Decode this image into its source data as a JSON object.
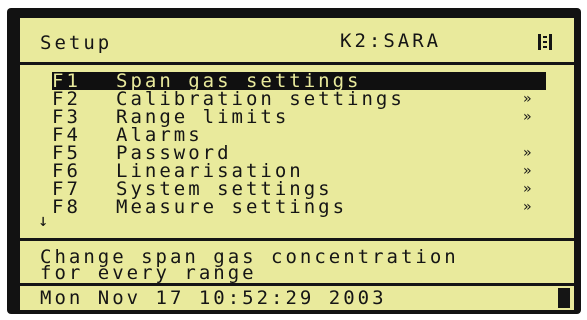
{
  "header": {
    "title": "Setup",
    "context": "K2:SARA",
    "menu_icon": "list-icon"
  },
  "menu": {
    "items": [
      {
        "key": "F1",
        "label": "Span gas settings",
        "selected": true,
        "submenu": ""
      },
      {
        "key": "F2",
        "label": "Calibration settings",
        "selected": false,
        "submenu": "»"
      },
      {
        "key": "F3",
        "label": "Range limits",
        "selected": false,
        "submenu": "»"
      },
      {
        "key": "F4",
        "label": "Alarms",
        "selected": false,
        "submenu": ""
      },
      {
        "key": "F5",
        "label": "Password",
        "selected": false,
        "submenu": "»"
      },
      {
        "key": "F6",
        "label": "Linearisation",
        "selected": false,
        "submenu": "»"
      },
      {
        "key": "F7",
        "label": "System settings",
        "selected": false,
        "submenu": "»"
      },
      {
        "key": "F8",
        "label": "Measure settings",
        "selected": false,
        "submenu": "»"
      }
    ],
    "scroll_indicator": "↓"
  },
  "help": {
    "line1": "Change span gas concentration",
    "line2": "for every range"
  },
  "status": {
    "datetime": "Mon Nov 17 10:52:29 2003"
  },
  "colors": {
    "lcd_background": "#e9ea9c",
    "lcd_foreground": "#151515",
    "bezel": "#121212"
  }
}
